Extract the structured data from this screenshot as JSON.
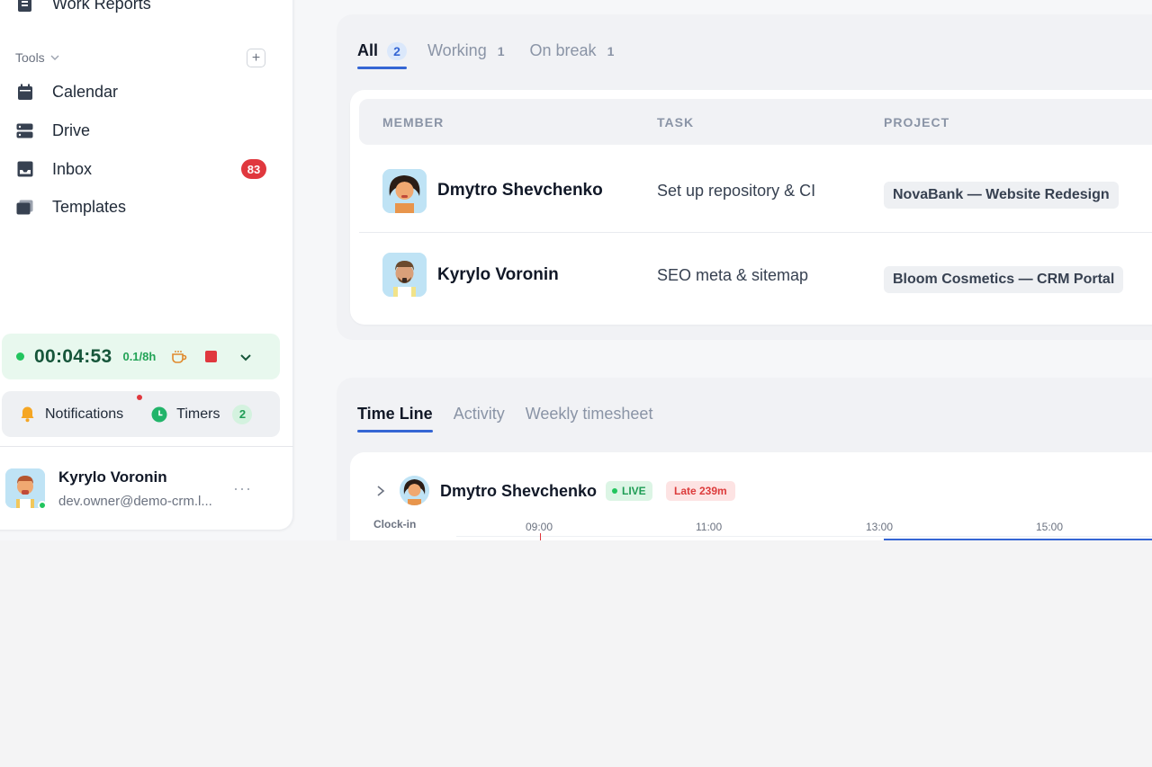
{
  "sidebar": {
    "top_item": {
      "label": "Work Reports",
      "icon": "document-icon"
    },
    "tools_section": {
      "label": "Tools",
      "add_symbol": "+"
    },
    "tools": [
      {
        "label": "Calendar",
        "icon": "calendar-icon"
      },
      {
        "label": "Drive",
        "icon": "drive-icon"
      },
      {
        "label": "Inbox",
        "icon": "inbox-icon",
        "badge": "83"
      },
      {
        "label": "Templates",
        "icon": "templates-icon"
      }
    ],
    "timer": {
      "time": "00:04:53",
      "ratio": "0.1/8h"
    },
    "utilities": {
      "notifications_label": "Notifications",
      "timers_label": "Timers",
      "timers_count": "2"
    },
    "user": {
      "name": "Kyrylo Voronin",
      "email": "dev.owner@demo-crm.l...",
      "menu": "···"
    }
  },
  "status_tabs": [
    {
      "label": "All",
      "count": "2",
      "active": true
    },
    {
      "label": "Working",
      "count": "1",
      "active": false
    },
    {
      "label": "On break",
      "count": "1",
      "active": false
    }
  ],
  "table": {
    "headers": [
      "MEMBER",
      "TASK",
      "PROJECT"
    ],
    "rows": [
      {
        "member": "Dmytro Shevchenko",
        "task": "Set up repository & CI",
        "project": "NovaBank — Website Redesign"
      },
      {
        "member": "Kyrylo Voronin",
        "task": "SEO meta & sitemap",
        "project": "Bloom Cosmetics — CRM Portal"
      }
    ]
  },
  "timeline_tabs": [
    {
      "label": "Time Line",
      "active": true
    },
    {
      "label": "Activity",
      "active": false
    },
    {
      "label": "Weekly timesheet",
      "active": false
    }
  ],
  "timeline": {
    "member": "Dmytro Shevchenko",
    "live_label": "LIVE",
    "late_label": "Late 239m",
    "clockin_label": "Clock-in",
    "ticks": [
      "09:00",
      "11:00",
      "13:00",
      "15:00"
    ]
  },
  "colors": {
    "accent": "#3566d4",
    "danger": "#e0383e",
    "success": "#22c55e"
  }
}
